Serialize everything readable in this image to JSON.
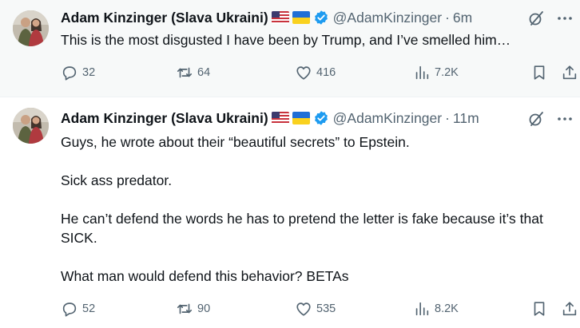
{
  "tweets": [
    {
      "author_name": "Adam Kinzinger (Slava Ukraini)",
      "handle": "@AdamKinzinger",
      "separator": "·",
      "time": "6m",
      "text": [
        "This is the most disgusted I have been by Trump, and I’ve smelled him…"
      ],
      "replies": "32",
      "reposts": "64",
      "likes": "416",
      "views": "7.2K"
    },
    {
      "author_name": "Adam Kinzinger (Slava Ukraini)",
      "handle": "@AdamKinzinger",
      "separator": "·",
      "time": "11m",
      "text": [
        "Guys, he wrote about their “beautiful secrets” to Epstein.",
        "Sick ass predator.",
        "He can’t defend the words he has to pretend the letter is fake because it’s that SICK.",
        "What man would defend this behavior?  BETAs"
      ],
      "replies": "52",
      "reposts": "90",
      "likes": "535",
      "views": "8.2K"
    }
  ],
  "icons": {
    "reply": "speech-bubble-icon",
    "repost": "repost-arrows-icon",
    "like": "heart-icon",
    "views": "bar-chart-icon",
    "bookmark": "bookmark-icon",
    "share": "share-upload-icon",
    "grok": "grok-slash-circle-icon",
    "more": "more-dots-icon",
    "verified": "verified-badge-icon",
    "flag_us": "us-flag-icon",
    "flag_ua": "ukraine-flag-icon"
  },
  "colors": {
    "text": "#0f1419",
    "muted": "#536471",
    "verified": "#1d9bf0",
    "highlight_bg": "#f7f9f9"
  }
}
